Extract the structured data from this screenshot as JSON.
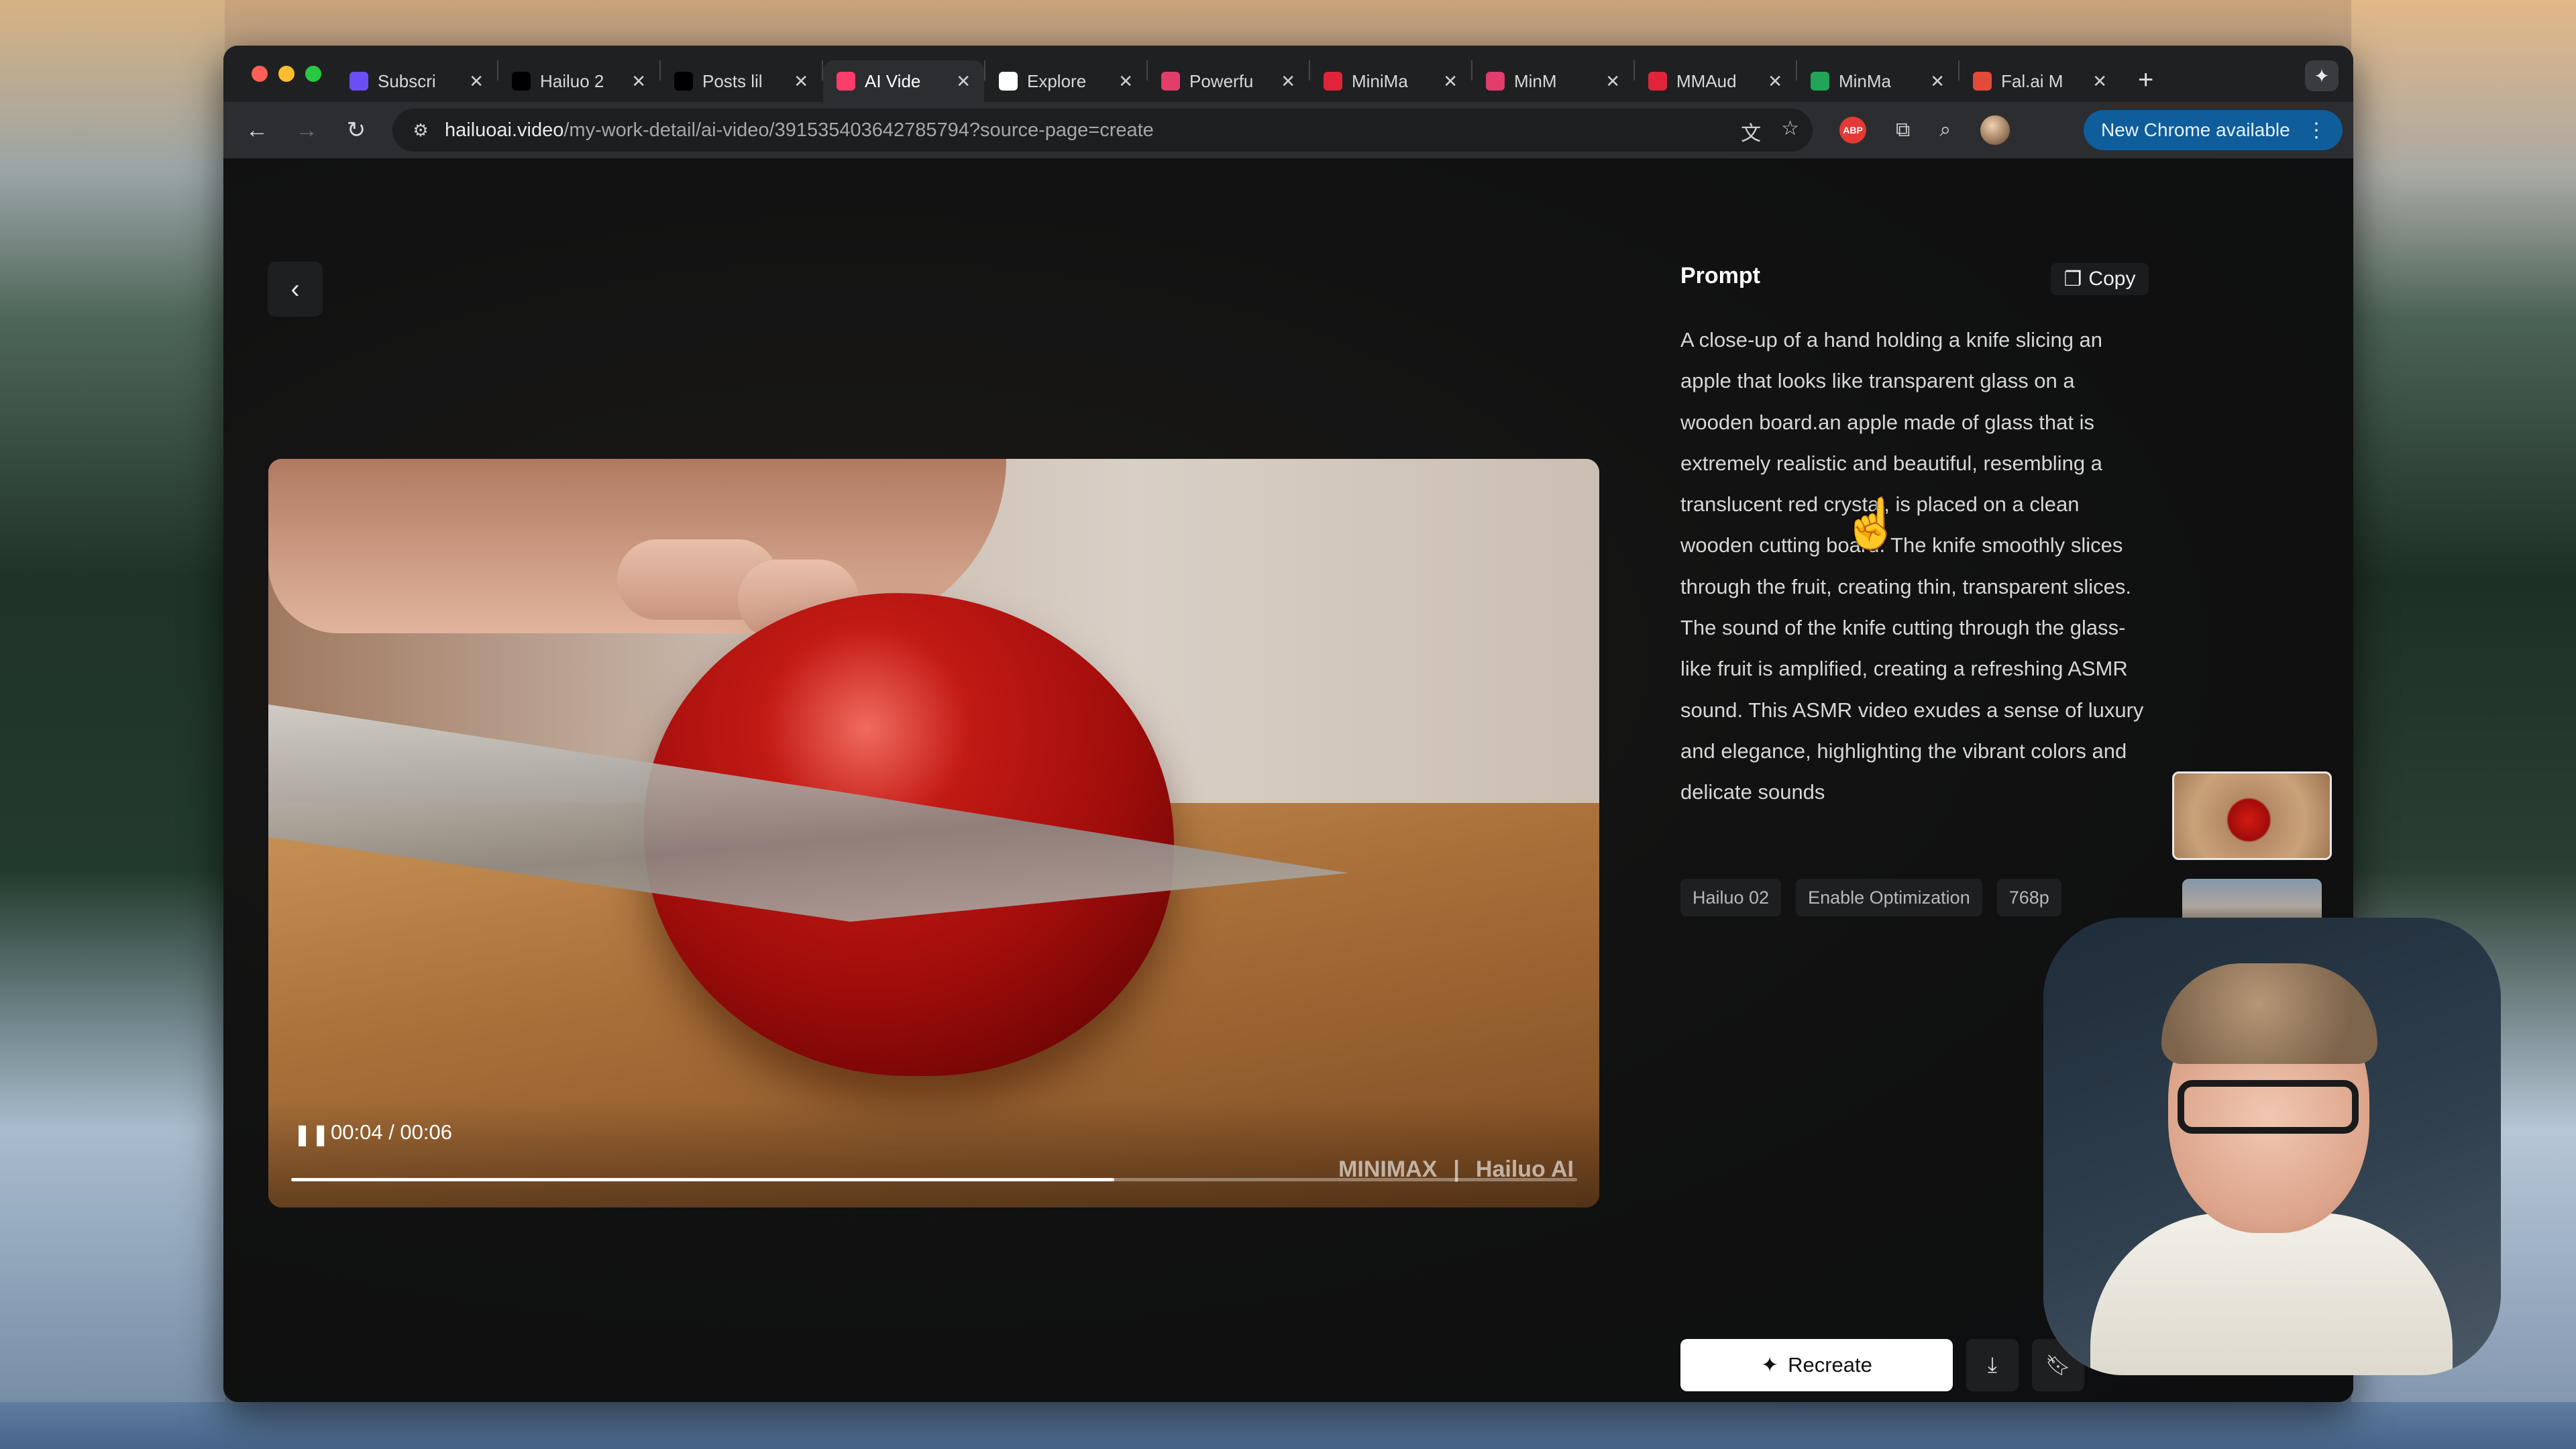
{
  "browser": {
    "tabs": [
      {
        "label": "Subscri",
        "icon": "hailuo-purple-icon",
        "color": "#6c4ef5"
      },
      {
        "label": "Hailuo 2",
        "icon": "threads-icon",
        "color": "#000000"
      },
      {
        "label": "Posts lil",
        "icon": "x-icon",
        "color": "#000000"
      },
      {
        "label": "AI Vide",
        "icon": "ai-video-icon",
        "color": "#ff3d6b"
      },
      {
        "label": "Explore",
        "icon": "explore-icon",
        "color": "#ffffff"
      },
      {
        "label": "Powerfu",
        "icon": "powerful-icon",
        "color": "#e23d6b"
      },
      {
        "label": "MiniMa",
        "icon": "minimax-icon",
        "color": "#e0253b"
      },
      {
        "label": "MinM",
        "icon": "minimax-video-icon",
        "color": "#e23d6b"
      },
      {
        "label": "MMAud",
        "icon": "mmaudio-icon",
        "color": "#e0253b"
      },
      {
        "label": "MinMa",
        "icon": "sheets-icon",
        "color": "#22a559"
      },
      {
        "label": "Fal.ai M",
        "icon": "fal-icon",
        "color": "#e24a3b"
      }
    ],
    "close_glyph": "✕",
    "new_tab_glyph": "+",
    "url_host": "hailuoai.video",
    "url_path": "/my-work-detail/ai-video/391535403642785794?source-page=create",
    "update_label": "New Chrome available"
  },
  "page": {
    "prompt_heading": "Prompt",
    "copy_label": "Copy",
    "prompt_text": "A close-up of a hand holding a knife slicing an apple that looks like transparent glass on a wooden board.an apple made of glass that is extremely realistic and beautiful, resembling a translucent red crystal, is placed on a clean wooden cutting board. The knife smoothly slices through the fruit, creating thin, transparent slices. The sound of the knife cutting through the glass-like fruit is amplified, creating a refreshing ASMR sound. This ASMR video exudes a sense of luxury and elegance, highlighting the vibrant colors and delicate sounds",
    "chips": [
      "Hailuo 02",
      "Enable Optimization",
      "768p"
    ],
    "recreate_label": "Recreate"
  },
  "video": {
    "current_time": "00:04",
    "duration": "00:06",
    "progress": 0.64,
    "watermark_brand": "MINIMAX",
    "watermark_product": "Hailuo AI"
  }
}
